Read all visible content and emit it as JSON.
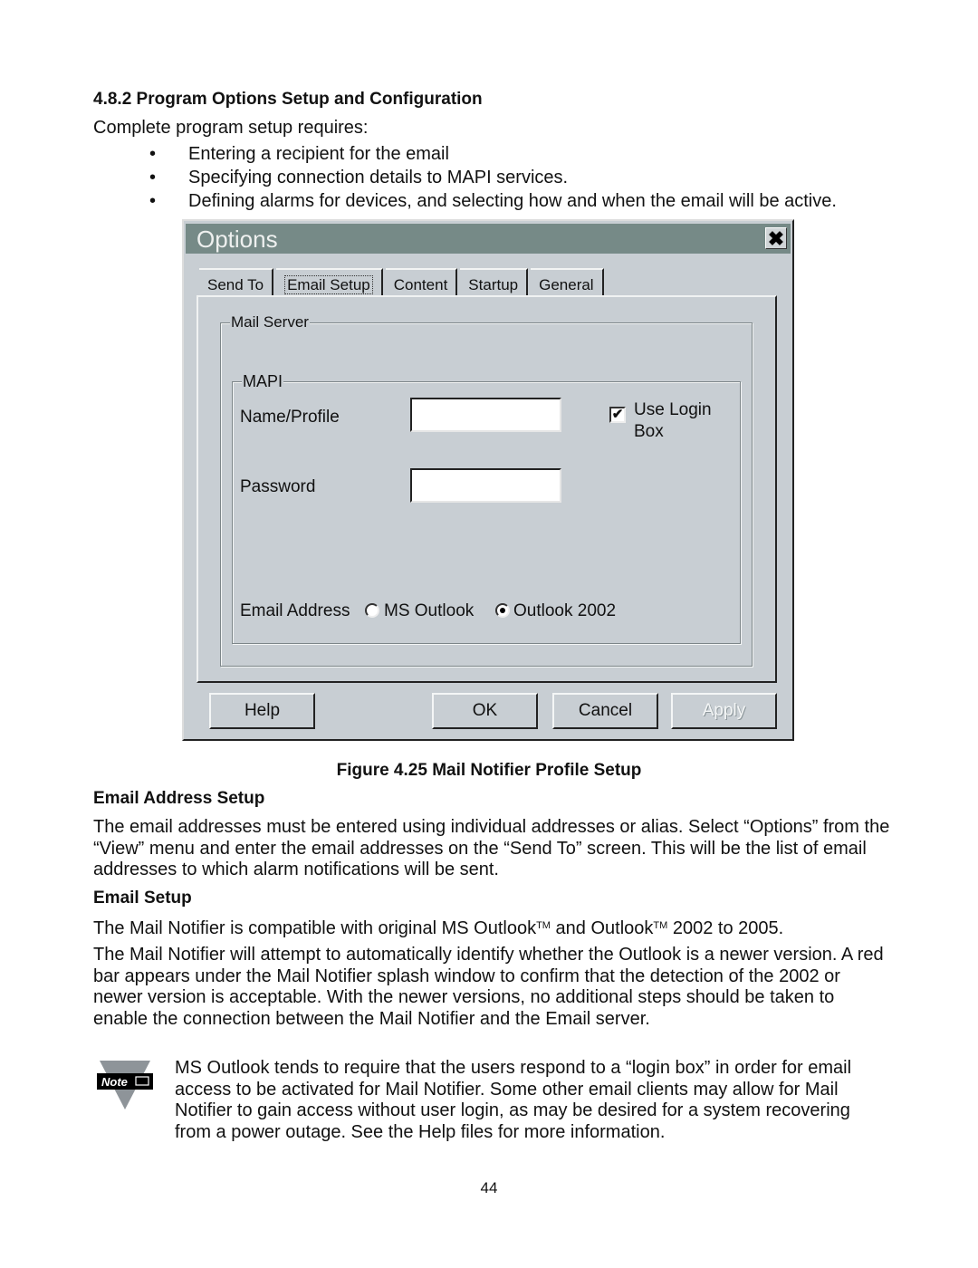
{
  "section": {
    "heading": "4.8.2  Program Options Setup and Configuration",
    "intro": "Complete program setup requires:",
    "bullets": [
      "Entering a recipient for the email",
      "Specifying connection details to MAPI services.",
      "Defining alarms for devices, and selecting how and when the email will be active."
    ],
    "bullet_glyph": "•"
  },
  "dialog": {
    "title": "Options",
    "close_glyph": "✖",
    "tabs": [
      {
        "label": "Send To",
        "active": false
      },
      {
        "label": "Email Setup",
        "active": true
      },
      {
        "label": "Content",
        "active": false
      },
      {
        "label": "Startup",
        "active": false
      },
      {
        "label": "General",
        "active": false
      }
    ],
    "mail_server_group": "Mail Server",
    "mapi_group": "MAPI",
    "name_profile_label": "Name/Profile",
    "name_profile_value": "",
    "password_label": "Password",
    "password_value": "",
    "use_login_box": {
      "label_line1": "Use Login",
      "label_line2": "Box",
      "checked": true,
      "glyph": "✔"
    },
    "email_address_label": "Email Address",
    "radio_options": [
      {
        "label": "MS Outlook",
        "selected": false
      },
      {
        "label": "Outlook 2002",
        "selected": true
      }
    ],
    "buttons": {
      "help": "Help",
      "ok": "OK",
      "cancel": "Cancel",
      "apply": "Apply"
    }
  },
  "figure_caption": "Figure 4.25  Mail Notifier Profile Setup",
  "email_address_setup": {
    "heading": "Email Address Setup",
    "text": "The email addresses must be entered using individual addresses or alias. Select “Options” from the “View” menu and enter the email addresses on the “Send To” screen. This will be the list of email addresses to which alarm notifications will be sent."
  },
  "email_setup": {
    "heading": "Email Setup",
    "compat_part1": "The Mail Notifier is compatible with original MS Outlook",
    "tm": "TM",
    "compat_part2": " and Outlook",
    "compat_part3": " 2002 to 2005.",
    "detect_text": "The Mail Notifier will attempt to automatically identify whether the Outlook is a newer version.  A red bar appears under the Mail Notifier splash window to confirm that the detection of the 2002 or newer version is acceptable.  With the newer versions, no additional steps should be taken to enable the connection between the Mail Notifier and the Email server."
  },
  "note": {
    "icon_label": "Note",
    "text": "MS Outlook tends to require that the users respond to a “login box” in order for email access to be activated for Mail Notifier.  Some other email clients may allow for Mail Notifier to gain access without user login, as may be desired for a system recovering from a power outage.  See the Help files for more information."
  },
  "page_number": "44"
}
